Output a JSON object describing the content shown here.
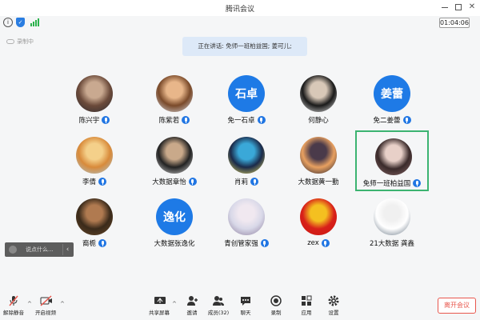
{
  "window": {
    "title": "腾讯会议"
  },
  "status": {
    "timer": "01:04:06",
    "recording_label": "录制中"
  },
  "banner": {
    "text": "正在讲话: 免师一班柏益国; 姜可儿;"
  },
  "participants": [
    {
      "name": "陈兴宇",
      "avatar_type": "photo",
      "avatar_colors": [
        "#6b4a3a",
        "#c9a990",
        "#2d2d33"
      ],
      "mic": true
    },
    {
      "name": "陈紫若",
      "avatar_type": "photo",
      "avatar_colors": [
        "#7a4a2a",
        "#e8b68a",
        "#d8dde6"
      ],
      "mic": true
    },
    {
      "name": "免一石卓",
      "avatar_type": "text",
      "avatar_text": "石卓",
      "mic": true
    },
    {
      "name": "何静心",
      "avatar_type": "photo",
      "avatar_colors": [
        "#1a1a1a",
        "#d8c8b8",
        "#eeeeee"
      ],
      "mic": false
    },
    {
      "name": "免二姜蕾",
      "avatar_type": "text",
      "avatar_text": "姜蕾",
      "mic": true
    },
    {
      "name": "李倩",
      "avatar_type": "photo",
      "avatar_colors": [
        "#d88a3a",
        "#f4d08a",
        "#a8c8d8"
      ],
      "mic": true
    },
    {
      "name": "大数据章怡",
      "avatar_type": "photo",
      "avatar_colors": [
        "#222222",
        "#c9a98a",
        "#e0e0e0"
      ],
      "mic": true
    },
    {
      "name": "肖莉",
      "avatar_type": "photo",
      "avatar_colors": [
        "#1a2a4a",
        "#3aa8d8",
        "#f0e060"
      ],
      "mic": true
    },
    {
      "name": "大数据黄一勤",
      "avatar_type": "photo",
      "avatar_colors": [
        "#e8a060",
        "#4a3a4a",
        "#1a1a2a"
      ],
      "mic": false
    },
    {
      "name": "免师一班柏益国",
      "avatar_type": "photo",
      "avatar_colors": [
        "#3a2a2a",
        "#e8d0c8",
        "#8a6a6a"
      ],
      "mic": true,
      "active": true
    },
    {
      "name": "裔栀",
      "avatar_type": "photo",
      "avatar_colors": [
        "#3a2a1a",
        "#b07a50",
        "#6a4a2a"
      ],
      "mic": true
    },
    {
      "name": "大数据张逸化",
      "avatar_type": "text",
      "avatar_text": "逸化",
      "mic": false
    },
    {
      "name": "青创管家强",
      "avatar_type": "photo",
      "avatar_colors": [
        "#d8d8e8",
        "#f0e8f0",
        "#8a7a9a"
      ],
      "mic": true
    },
    {
      "name": "zex",
      "avatar_type": "photo",
      "avatar_colors": [
        "#d8201a",
        "#f4c020",
        "#c81810"
      ],
      "mic": true
    },
    {
      "name": "21大数据 龚鑫",
      "avatar_type": "photo",
      "avatar_colors": [
        "#ffffff",
        "#f0f0f0",
        "#5a6a7a"
      ],
      "mic": false
    }
  ],
  "chat": {
    "placeholder": "说点什么..."
  },
  "toolbar": {
    "unmute": "解除静音",
    "video": "开启视频",
    "share": "共享屏幕",
    "invite": "邀请",
    "members": "成员(32)",
    "chat": "聊天",
    "record": "录制",
    "apps": "应用",
    "settings": "设置",
    "leave": "离开会议"
  },
  "colors": {
    "accent": "#1e7ae6",
    "active_border": "#3cb371",
    "leave": "#e8574d",
    "muted": "#e8574d"
  },
  "icons": [
    "info-icon",
    "shield-icon",
    "signal-icon",
    "cloud-icon",
    "mic-muted-icon",
    "video-off-icon",
    "share-screen-icon",
    "invite-icon",
    "members-icon",
    "chat-icon",
    "record-icon",
    "apps-icon",
    "settings-icon"
  ]
}
